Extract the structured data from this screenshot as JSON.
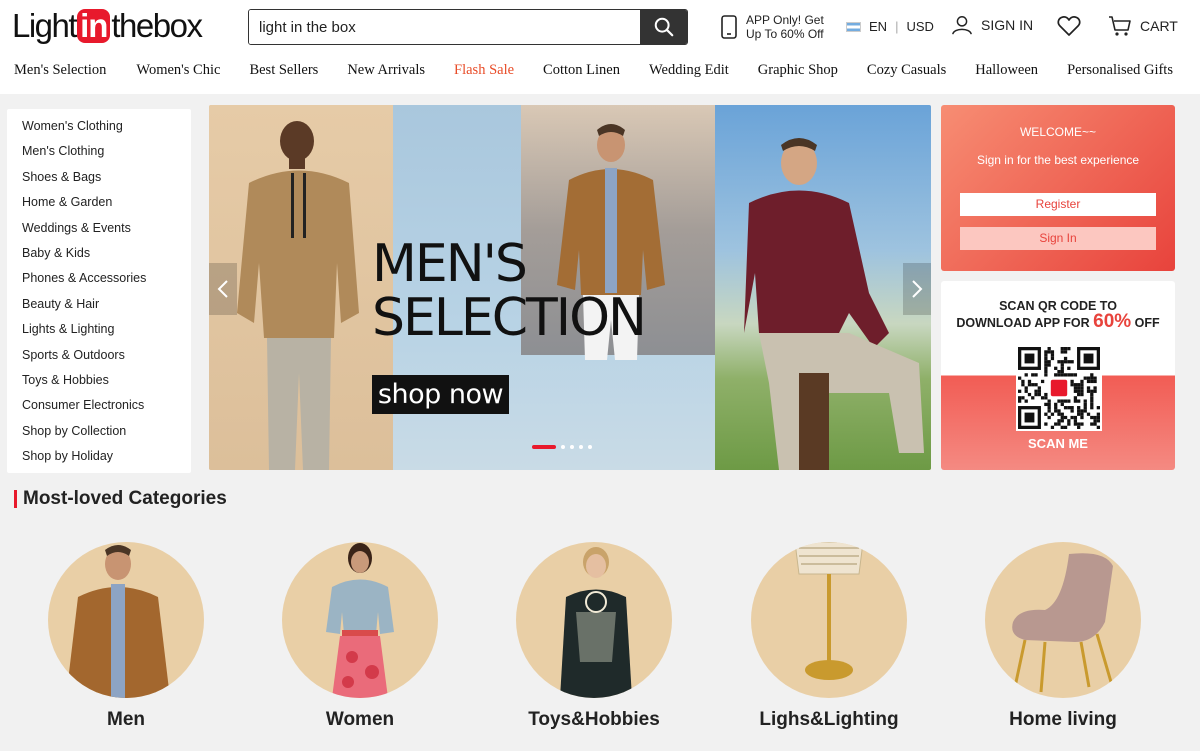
{
  "header": {
    "logo": {
      "part1": "Light",
      "part2": "in",
      "part3": "thebox"
    },
    "search": {
      "value": "light in the box",
      "placeholder": ""
    },
    "app_promo": {
      "line1": "APP Only! Get",
      "line2": "Up To 60% Off"
    },
    "language": "EN",
    "currency": "USD",
    "sign_in": "SIGN IN",
    "cart": "CART"
  },
  "nav": [
    "Men's Selection",
    "Women's Chic",
    "Best Sellers",
    "New Arrivals",
    "Flash Sale",
    "Cotton Linen",
    "Wedding Edit",
    "Graphic Shop",
    "Cozy Casuals",
    "Halloween",
    "Personalised Gifts"
  ],
  "sidebar": [
    "Women's Clothing",
    "Men's Clothing",
    "Shoes & Bags",
    "Home & Garden",
    "Weddings & Events",
    "Baby & Kids",
    "Phones & Accessories",
    "Beauty & Hair",
    "Lights & Lighting",
    "Sports & Outdoors",
    "Toys & Hobbies",
    "Consumer Electronics",
    "Shop by Collection",
    "Shop by Holiday"
  ],
  "banner": {
    "title": "MEN'S\nSELECTION",
    "cta": "shop now",
    "slides": 5,
    "active_slide": 1
  },
  "welcome": {
    "title": "WELCOME~~",
    "subtitle": "Sign in for the best experience",
    "register": "Register",
    "sign_in": "Sign In"
  },
  "qr": {
    "line1": "SCAN QR CODE TO",
    "line2": "DOWNLOAD APP FOR",
    "percent": "60%",
    "off": "OFF",
    "scan": "SCAN ME"
  },
  "most_loved": {
    "title": "Most-loved Categories",
    "items": [
      "Men",
      "Women",
      "Toys&Hobbies",
      "Lighs&Lighting",
      "Home living"
    ]
  },
  "colors": {
    "accent": "#e8192c",
    "flash": "#e84c28",
    "welcome_from": "#f78d73",
    "welcome_to": "#e8433c"
  }
}
